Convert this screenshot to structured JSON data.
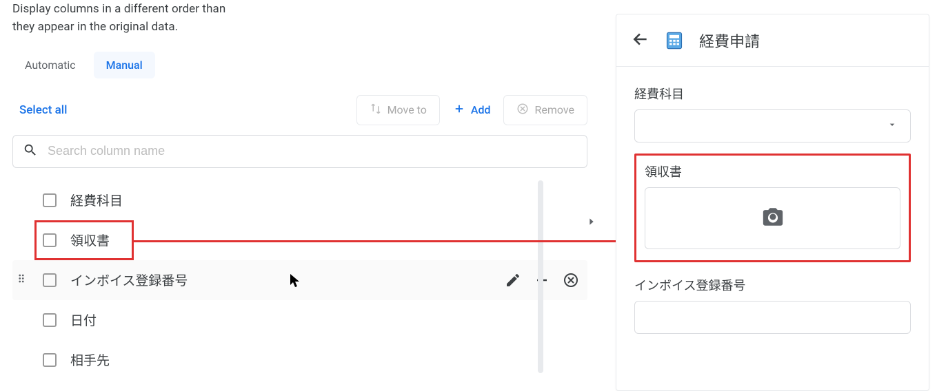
{
  "description": "Display columns in a different order than they appear in the original data.",
  "tabs": {
    "automatic": "Automatic",
    "manual": "Manual",
    "active": "manual"
  },
  "actions": {
    "select_all": "Select all",
    "move_to": "Move to",
    "add": "Add",
    "remove": "Remove"
  },
  "search": {
    "placeholder": "Search column name",
    "value": ""
  },
  "columns": {
    "items": [
      {
        "label": "経費科目"
      },
      {
        "label": "領収書"
      },
      {
        "label": "インボイス登録番号"
      },
      {
        "label": "日付"
      },
      {
        "label": "相手先"
      }
    ]
  },
  "preview": {
    "title": "経費申請",
    "fields": {
      "account_label": "経費科目",
      "receipt_label": "領収書",
      "invoice_label": "インボイス登録番号"
    }
  }
}
